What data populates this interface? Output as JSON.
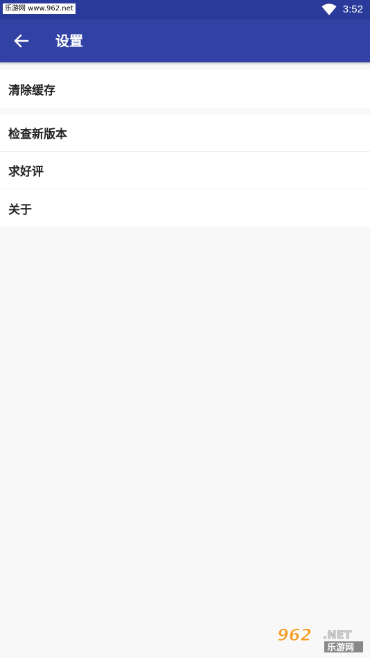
{
  "status_bar": {
    "watermark": "乐游网 www.962.net",
    "time": "3:52",
    "icons": [
      "wifi-icon"
    ]
  },
  "app_bar": {
    "title": "设置",
    "back_icon": "arrow-left-icon"
  },
  "settings": {
    "group1": [
      {
        "label": "清除缓存"
      }
    ],
    "group2": [
      {
        "label": "检查新版本"
      },
      {
        "label": "求好评"
      },
      {
        "label": "关于"
      }
    ]
  },
  "watermark_logo": {
    "number": "962",
    "suffix": ".NET",
    "cn": "乐游网"
  },
  "colors": {
    "status_bar": "#2a3a9b",
    "app_bar": "#3242a4",
    "background": "#f8f8f8",
    "row": "#ffffff",
    "logo_orange": "#f39a1e"
  }
}
